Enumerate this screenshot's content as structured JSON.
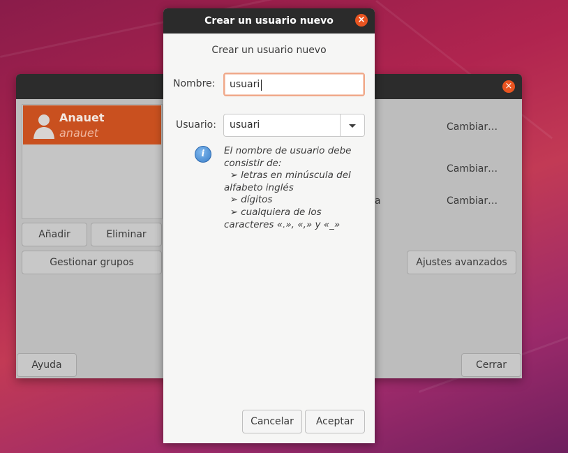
{
  "background_window": {
    "user": {
      "name": "Anauet",
      "login": "anauet"
    },
    "buttons": {
      "add": "Añadir",
      "remove": "Eliminar",
      "manage_groups": "Gestionar grupos",
      "help": "Ayuda",
      "close": "Cerrar",
      "advanced": "Ajustes avanzados"
    },
    "change_links": [
      "Cambiar…",
      "Cambiar…",
      "Cambiar…"
    ],
    "fragment": "a",
    "close_icon": "×"
  },
  "dialog": {
    "title": "Crear un usuario nuevo",
    "header": "Crear un usuario nuevo",
    "close_icon": "×",
    "name_label": "Nombre:",
    "name_value": "usuari",
    "username_label": "Usuario:",
    "username_value": "usuari",
    "info_icon": "i",
    "hint_lines": [
      "El nombre de usuario debe",
      "consistir de:",
      "  ➢ letras en minúscula del",
      "alfabeto inglés",
      "  ➢ dígitos",
      "  ➢ cualquiera de los",
      "caracteres «.», «,» y «_»"
    ],
    "cancel": "Cancelar",
    "accept": "Aceptar"
  },
  "colors": {
    "accent": "#e95420",
    "selection": "#c9501f",
    "titlebar": "#2b2b2b"
  }
}
